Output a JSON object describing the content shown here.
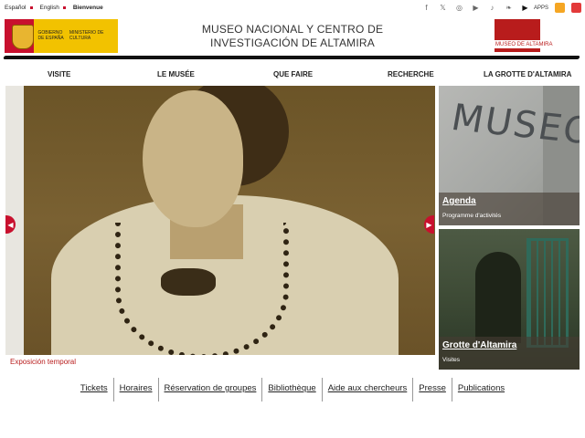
{
  "languages": [
    {
      "label": "Español",
      "active": false
    },
    {
      "label": "English",
      "active": false
    },
    {
      "label": "Bienvenue",
      "active": true
    }
  ],
  "social": {
    "icons": [
      "facebook-icon",
      "x-icon",
      "instagram-icon",
      "youtube-icon",
      "tiktok-icon",
      "bluesky-icon",
      "play-icon"
    ],
    "apps_label": "APPS"
  },
  "gov": {
    "line1": "GOBIERNO DE ESPAÑA",
    "line2": "MINISTERIO DE CULTURA"
  },
  "header": {
    "title_line1": "MUSEO NACIONAL Y CENTRO DE",
    "title_line2": "INVESTIGACIÓN DE ALTAMIRA",
    "logo_text": "MUSEO DE ALTAMIRA"
  },
  "nav": {
    "items": [
      "VISITE",
      "LE MUSÉE",
      "QUE FAIRE",
      "RECHERCHE",
      "LA GROTTE D'ALTAMIRA"
    ]
  },
  "hero": {
    "caption": "Exposición temporal"
  },
  "cards": [
    {
      "title": "Agenda",
      "subtitle": "Programme d'activités"
    },
    {
      "title": "Grotte d'Altamira",
      "subtitle": "Visites"
    }
  ],
  "museo_sign": "MUSEO",
  "quick_links": [
    "Tickets",
    "Horaires",
    "Réservation de groupes",
    "Bibliothèque",
    "Aide aux chercheurs",
    "Presse",
    "Publications"
  ],
  "colors": {
    "accent": "#c8102e",
    "gov_yellow": "#f2c200",
    "logo_red": "#b81c1c"
  }
}
